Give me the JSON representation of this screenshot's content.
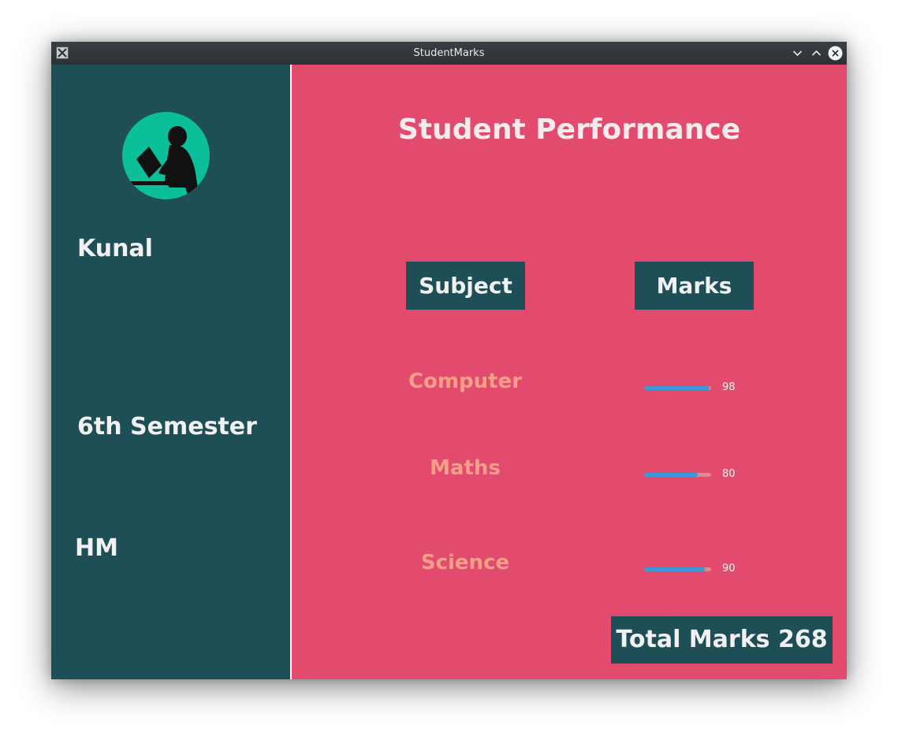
{
  "window": {
    "title": "StudentMarks",
    "app_icon": "x-app-icon",
    "controls": [
      "chevron-down-icon",
      "chevron-up-icon",
      "close-icon"
    ]
  },
  "sidebar": {
    "avatar_icon": "student-reading-icon",
    "name": "Kunal",
    "semester": "6th Semester",
    "branch": "HM"
  },
  "main": {
    "title": "Student Performance",
    "subject_header": "Subject",
    "marks_header": "Marks",
    "subjects": [
      {
        "name": "Computer",
        "marks": "98",
        "progress": 0.98
      },
      {
        "name": "Maths",
        "marks": "80",
        "progress": 0.8
      },
      {
        "name": "Science",
        "marks": "90",
        "progress": 0.9
      }
    ],
    "total_label": "Total Marks 268"
  },
  "colors": {
    "sidebar_bg": "#1e4f56",
    "main_bg": "#e24b6e",
    "subject_text": "#f59f8a",
    "bar_fill": "#3a9ad9",
    "bar_track": "#e5858e",
    "avatar_bg": "#0bbf9a"
  }
}
